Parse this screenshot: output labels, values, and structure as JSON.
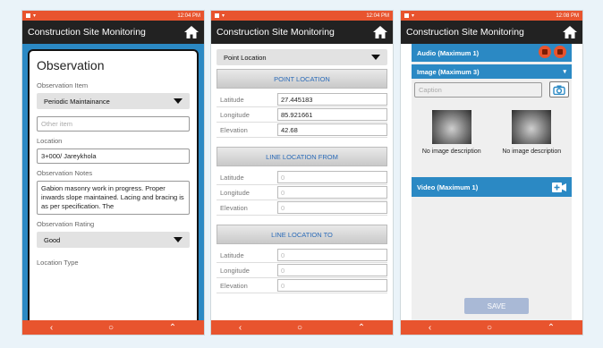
{
  "phones": [
    {
      "status_time": "12:04 PM",
      "app_title": "Construction Site Monitoring"
    },
    {
      "status_time": "12:04 PM",
      "app_title": "Construction Site Monitoring"
    },
    {
      "status_time": "12:08 PM",
      "app_title": "Construction Site Monitoring"
    }
  ],
  "nav": {
    "back": "‹",
    "home": "○",
    "recent": "⌃"
  },
  "observation": {
    "heading": "Observation",
    "item_label": "Observation Item",
    "item_value": "Periodic Maintainance",
    "other_placeholder": "Other item",
    "location_label": "Location",
    "location_value": "3+000/ Jareykhola",
    "notes_label": "Observation Notes",
    "notes_value": "Gabion masonry work in progress. Proper inwards slope maintained. Lacing and bracing is as per specification. The",
    "rating_label": "Observation Rating",
    "rating_value": "Good",
    "loc_type_label": "Location Type"
  },
  "location": {
    "type_select": "Point Location",
    "point_header": "POINT LOCATION",
    "point_rows": [
      {
        "label": "Latitude",
        "value": "27.445183"
      },
      {
        "label": "Longitude",
        "value": "85.921661"
      },
      {
        "label": "Elevation",
        "value": "42.68"
      }
    ],
    "from_header": "LINE LOCATION FROM",
    "from_rows": [
      {
        "label": "Latitude",
        "value": "0"
      },
      {
        "label": "Longitude",
        "value": "0"
      },
      {
        "label": "Elevation",
        "value": "0"
      }
    ],
    "to_header": "LINE LOCATION TO",
    "to_rows": [
      {
        "label": "Latitude",
        "value": "0"
      },
      {
        "label": "Longitude",
        "value": "0"
      },
      {
        "label": "Elevation",
        "value": "0"
      }
    ]
  },
  "media": {
    "audio_label": "Audio (Maximum 1)",
    "image_label": "Image (Maximum 3)",
    "caption_placeholder": "Caption",
    "images": [
      {
        "description": "No image description"
      },
      {
        "description": "No image description"
      }
    ],
    "video_label": "Video (Maximum 1)",
    "save_label": "SAVE"
  }
}
